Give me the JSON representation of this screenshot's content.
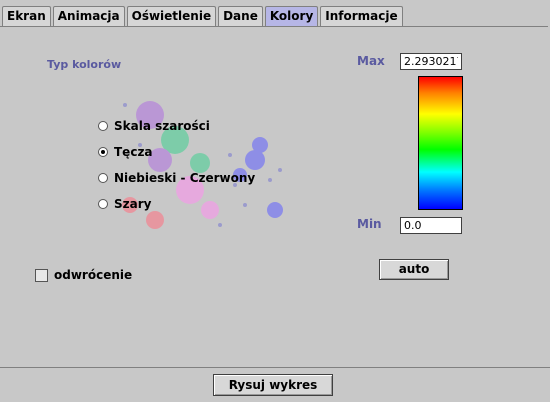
{
  "tabs": [
    {
      "label": "Ekran",
      "active": false
    },
    {
      "label": "Animacja",
      "active": false
    },
    {
      "label": "Oświetlenie",
      "active": false
    },
    {
      "label": "Dane",
      "active": false
    },
    {
      "label": "Kolory",
      "active": true
    },
    {
      "label": "Informacje",
      "active": false
    }
  ],
  "color_panel": {
    "title": "Typ kolorów",
    "options": [
      {
        "label": "Skala szarości",
        "selected": false
      },
      {
        "label": "Tęcza",
        "selected": true
      },
      {
        "label": "Niebieski - Czerwony",
        "selected": false
      },
      {
        "label": "Szary",
        "selected": false
      }
    ],
    "invert_label": "odwrócenie",
    "invert_checked": false
  },
  "range": {
    "max_label": "Max",
    "max_value": "2.2930217",
    "min_label": "Min",
    "min_value": "0.0",
    "auto_label": "auto"
  },
  "footer": {
    "draw_label": "Rysuj wykres"
  },
  "colors": {
    "background": "#c8c8c8",
    "active_tab": "#b6b6e6",
    "label_blue": "#5a5aa0"
  }
}
